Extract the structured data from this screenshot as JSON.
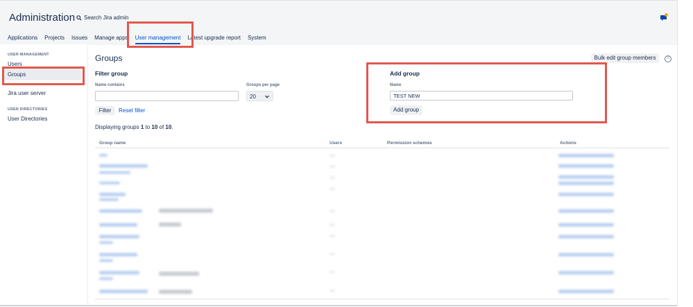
{
  "header": {
    "title": "Administration",
    "search_label": "Search Jira admin",
    "notification_icon": "notification-icon"
  },
  "nav": {
    "tabs": [
      {
        "label": "Applications",
        "active": false
      },
      {
        "label": "Projects",
        "active": false
      },
      {
        "label": "Issues",
        "active": false
      },
      {
        "label": "Manage apps",
        "active": false
      },
      {
        "label": "User management",
        "active": true
      },
      {
        "label": "Latest upgrade report",
        "active": false
      },
      {
        "label": "System",
        "active": false
      }
    ]
  },
  "sidebar": {
    "section_user_management": "USER MANAGEMENT",
    "items": [
      "Users",
      "Groups",
      "Jira user server"
    ],
    "active_item": "Groups",
    "section_user_directories": "USER DIRECTORIES",
    "directory_items": [
      "User Directories"
    ]
  },
  "main": {
    "title": "Groups",
    "bulk_edit_label": "Bulk edit group members",
    "filter": {
      "heading": "Filter group",
      "name_contains_label": "Name contains",
      "name_contains_value": "",
      "per_page_label": "Groups per page",
      "per_page_value": "20",
      "filter_button": "Filter",
      "reset_link": "Reset filter"
    },
    "add_group": {
      "heading": "Add group",
      "name_label": "Name",
      "name_value": "TEST NEW",
      "button": "Add group"
    },
    "displaying": {
      "prefix": "Displaying groups ",
      "from": "1",
      "to_text": " to ",
      "to": "10",
      "of_text": " of ",
      "total": "10",
      "suffix": "."
    },
    "table": {
      "columns": [
        "Group name",
        "Users",
        "Permission schemes",
        "Actions"
      ]
    }
  },
  "colors": {
    "accent": "#0052cc",
    "highlight_box": "#e1574c",
    "header_bg": "#f4f5f7"
  }
}
